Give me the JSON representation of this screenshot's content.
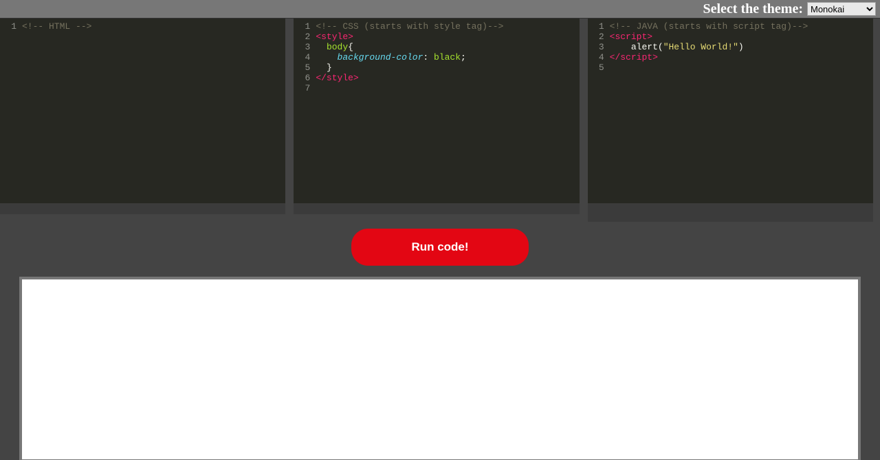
{
  "topbar": {
    "label": "Select the theme:",
    "theme_selected": "Monokai"
  },
  "run_button_label": "Run code!",
  "editor_html": {
    "line_numbers": [
      "1"
    ],
    "lines": [
      [
        {
          "t": "<!-- HTML -->",
          "c": "c-comment"
        }
      ]
    ]
  },
  "editor_css": {
    "line_numbers": [
      "1",
      "2",
      "3",
      "4",
      "5",
      "6",
      "7"
    ],
    "lines": [
      [
        {
          "t": "<!-- CSS (starts with style tag)-->",
          "c": "c-comment"
        }
      ],
      [
        {
          "t": "<style>",
          "c": "c-tag"
        }
      ],
      [
        {
          "t": "  ",
          "c": ""
        },
        {
          "t": "body",
          "c": "c-sel"
        },
        {
          "t": "{",
          "c": "c-default"
        }
      ],
      [
        {
          "t": "    ",
          "c": ""
        },
        {
          "t": "background-color",
          "c": "c-propcss"
        },
        {
          "t": ": ",
          "c": "c-default"
        },
        {
          "t": "black",
          "c": "c-sel"
        },
        {
          "t": ";",
          "c": "c-default"
        }
      ],
      [
        {
          "t": "  ",
          "c": ""
        },
        {
          "t": "}",
          "c": "c-default"
        }
      ],
      [
        {
          "t": "</style>",
          "c": "c-tag"
        }
      ],
      [
        {
          "t": "",
          "c": ""
        }
      ]
    ]
  },
  "editor_js": {
    "line_numbers": [
      "1",
      "2",
      "3",
      "4",
      "5"
    ],
    "lines": [
      [
        {
          "t": "<!-- JAVA (starts with script tag)-->",
          "c": "c-comment"
        }
      ],
      [
        {
          "t": "<script>",
          "c": "c-tag"
        }
      ],
      [
        {
          "t": "    ",
          "c": ""
        },
        {
          "t": "alert(",
          "c": "c-default"
        },
        {
          "t": "\"Hello World!\"",
          "c": "c-str"
        },
        {
          "t": ")",
          "c": "c-default"
        }
      ],
      [
        {
          "t": "</scr",
          "c": "c-tag"
        },
        {
          "t": "ipt>",
          "c": "c-tag"
        }
      ],
      [
        {
          "t": "",
          "c": ""
        }
      ]
    ]
  }
}
